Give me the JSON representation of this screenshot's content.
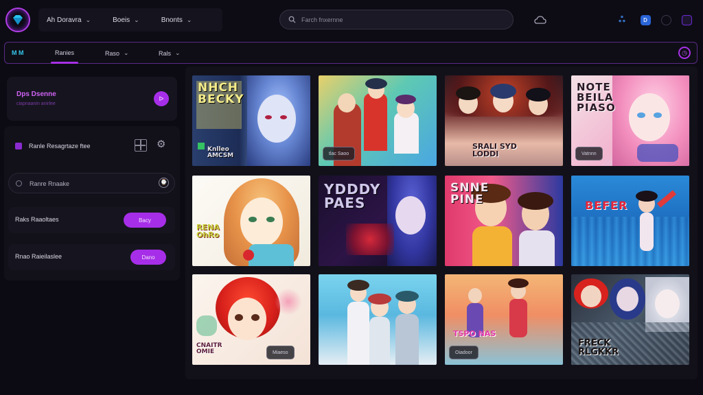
{
  "header": {
    "nav": [
      {
        "label": "Ah Doravra"
      },
      {
        "label": "Boeis"
      },
      {
        "label": "Bnonts"
      }
    ],
    "search_placeholder": "Farch fnxernne",
    "icons": [
      "cloud-icon",
      "user-badge-icon",
      "app-icon",
      "circle-icon",
      "square-icon"
    ]
  },
  "subnav": {
    "brand": "M M",
    "tabs": [
      {
        "label": "Ranies",
        "active": true
      },
      {
        "label": "Raso"
      },
      {
        "label": "Rals"
      }
    ]
  },
  "sidebar": {
    "profile_title": "Dps Dsenne",
    "profile_sub": "ciapnaanin anirlee",
    "filter_label": "Ranle Resagrtaze ftee",
    "search_label": "Ranre Rnaake",
    "row1_label": "Raks Raaoltaes",
    "row1_btn": "Bacy",
    "row2_label": "Rnao Raieilaslee",
    "row2_btn": "Dano"
  },
  "gallery": {
    "tiles": [
      {
        "title": "NHCH\nBECKY",
        "caption": "Knlleo\nAMCSM",
        "chip": ""
      },
      {
        "title": "",
        "caption": "",
        "chip": "tlac Saoo"
      },
      {
        "title": "",
        "caption": "SRALI SYD\nLODDI",
        "chip": ""
      },
      {
        "title": "NOTE\nBEILA\nPIASO",
        "caption": "",
        "chip": "Vatnnn"
      },
      {
        "title": "",
        "caption": "RENA\nOhRo",
        "chip": ""
      },
      {
        "title": "YDDDY\nPAES",
        "caption": "",
        "chip": ""
      },
      {
        "title": "SNNE\nPINE",
        "caption": "",
        "chip": ""
      },
      {
        "title": "BEFER",
        "caption": "",
        "chip": ""
      },
      {
        "title": "",
        "caption": "CNAITR\nOMIE",
        "chip": "Miaeso"
      },
      {
        "title": "",
        "caption": "",
        "chip": ""
      },
      {
        "title": "",
        "caption": "TSPO NAS",
        "chip": "Oiadoor"
      },
      {
        "title": "",
        "caption": "FRECK\nRLGKKR",
        "chip": ""
      }
    ]
  },
  "colors": {
    "accent": "#a72ee8",
    "background": "#0c0b13",
    "panel": "#16151f"
  }
}
